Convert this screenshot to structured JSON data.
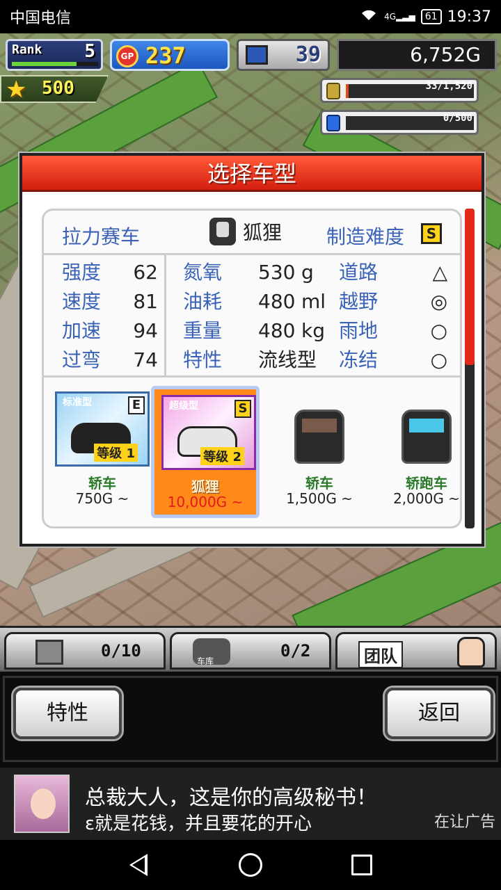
{
  "status_bar": {
    "carrier": "中国电信",
    "network": "4G 2G",
    "battery": "61",
    "time": "19:37"
  },
  "hud": {
    "rank_label": "Rank",
    "rank_value": "5",
    "rank_progress": 0.75,
    "gp_label": "GP",
    "gp_value": "237",
    "pc_value": "39",
    "money": "6,752G",
    "star_value": "500",
    "resource1": {
      "text": "33/1,520",
      "fill": 0.02
    },
    "resource2": {
      "text": "0/500",
      "fill": 0.0
    }
  },
  "modal": {
    "title": "选择车型",
    "category": "拉力赛车",
    "selected_car": "狐狸",
    "difficulty_label": "制造难度",
    "difficulty_grade": "S",
    "scroll_position": 0.49,
    "stats_left": [
      {
        "name": "强度",
        "value": "62"
      },
      {
        "name": "速度",
        "value": "81"
      },
      {
        "name": "加速",
        "value": "94"
      },
      {
        "name": "过弯",
        "value": "74"
      }
    ],
    "stats_mid": [
      {
        "name": "氮氧",
        "value": "530",
        "unit": "g"
      },
      {
        "name": "油耗",
        "value": "480",
        "unit": "ml"
      },
      {
        "name": "重量",
        "value": "480",
        "unit": "kg"
      },
      {
        "name": "特性",
        "value": "流线型",
        "unit": ""
      }
    ],
    "terrain": [
      {
        "name": "道路",
        "mark": "△"
      },
      {
        "name": "越野",
        "mark": "◎"
      },
      {
        "name": "雨地",
        "mark": "○"
      },
      {
        "name": "冻结",
        "mark": "○"
      }
    ],
    "cars": [
      {
        "name": "轿车",
        "price": "750G ~",
        "box_label": "标准型",
        "grade": "E",
        "level_label": "等级",
        "level": "1"
      },
      {
        "name": "狐狸",
        "price": "10,000G ~",
        "box_label": "超级型",
        "grade": "S",
        "level_label": "等级",
        "level": "2"
      },
      {
        "name": "轿车",
        "price": "1,500G ~"
      },
      {
        "name": "轿跑车",
        "price": "2,000G ~"
      }
    ]
  },
  "tabs": {
    "tab1_count": "0/10",
    "tab2_label": "车库",
    "tab2_count": "0/2",
    "team_label": "团队"
  },
  "buttons": {
    "left": "特性",
    "right": "返回"
  },
  "ad": {
    "line1": "总裁大人，这是你的高级秘书！",
    "line2": "ɛ就是花钱，并且要花的开心",
    "tag": "在让广告"
  }
}
